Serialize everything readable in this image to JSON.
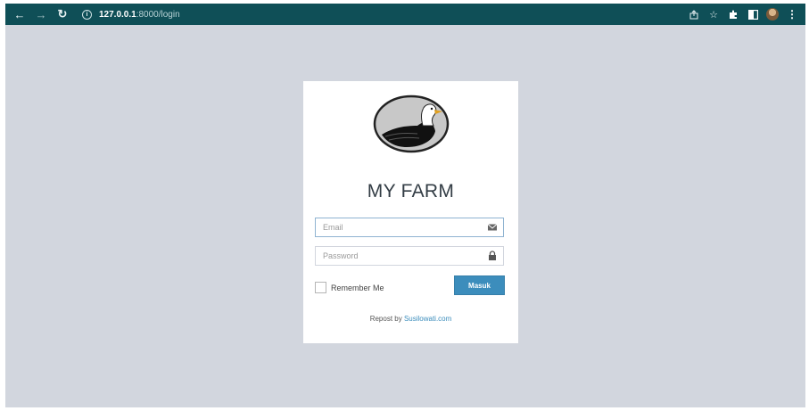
{
  "browser": {
    "url_host": "127.0.0.1",
    "url_path": ":8000/login",
    "icons": [
      "back-icon",
      "forward-icon",
      "reload-icon",
      "info-icon",
      "share-icon",
      "star-icon",
      "extensions-icon",
      "sidepanel-icon",
      "profile-avatar",
      "menu-icon"
    ]
  },
  "login": {
    "title": "MY FARM",
    "email_placeholder": "Email",
    "password_placeholder": "Password",
    "remember_label": "Remember Me",
    "submit_label": "Masuk",
    "footer_prefix": "Repost by ",
    "footer_link": "Susilowati.com"
  },
  "colors": {
    "browser_bar": "#0f4f57",
    "page_bg": "#d2d6de",
    "button": "#3c8dbc"
  }
}
